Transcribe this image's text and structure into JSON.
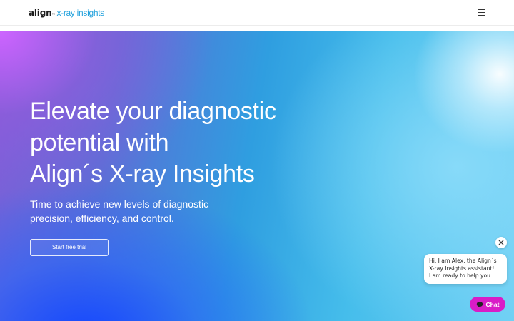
{
  "header": {
    "logo_brand": "align",
    "logo_tm": "™",
    "logo_product": "x-ray insights",
    "menu_icon": "hamburger-menu-icon"
  },
  "hero": {
    "title_lines": [
      "Elevate your diagnostic",
      "potential with",
      "Align´s X-ray Insights"
    ],
    "subtitle_lines": [
      "Time to achieve new levels of diagnostic",
      "precision, efficiency, and control."
    ],
    "cta_label": "Start free trial"
  },
  "chat_widget": {
    "close_icon": "close-icon",
    "message_lines": [
      "Hi, I am Alex, the Align´s",
      "X-ray Insights assistant!",
      "I am ready to help you"
    ],
    "chat_icon": "chat-bubble-icon",
    "chat_label": "Chat",
    "accent_color": "#d91cc7"
  },
  "colors": {
    "brand_blue": "#1fa0dc",
    "hero_gradient": [
      "#c864ff",
      "#2f9ee0",
      "#6fd0f4",
      "#1446ff"
    ]
  }
}
